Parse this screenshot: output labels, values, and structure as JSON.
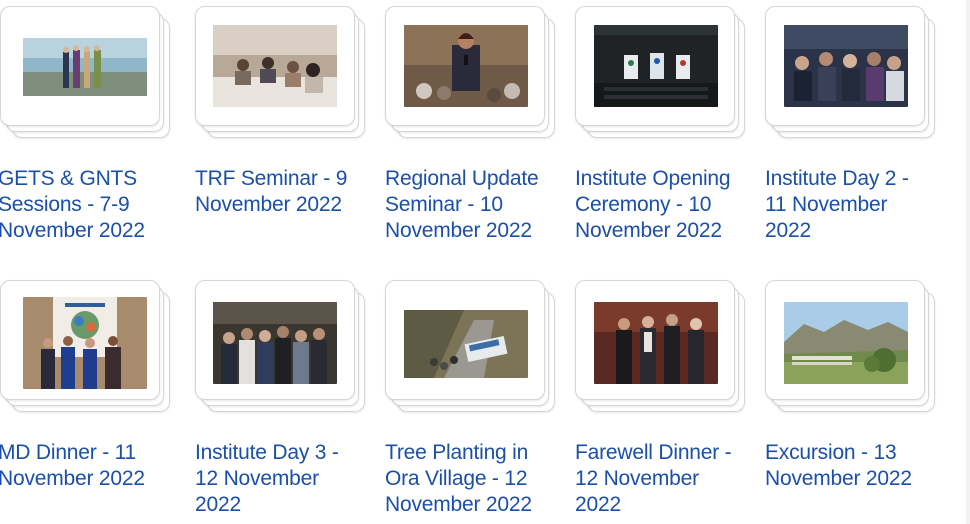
{
  "albums": [
    {
      "lines": [
        "GETS & GNTS",
        "Sessions - 7-9",
        "November 2022"
      ],
      "photo_icon": "group-photo-icon"
    },
    {
      "lines": [
        "TRF Seminar - 9",
        "November 2022"
      ],
      "photo_icon": "seminar-photo-icon"
    },
    {
      "lines": [
        "Regional Update",
        "Seminar - 10",
        "November 2022"
      ],
      "photo_icon": "speaker-photo-icon"
    },
    {
      "lines": [
        "Institute Opening",
        "Ceremony - 10",
        "November 2022"
      ],
      "photo_icon": "stage-photo-icon"
    },
    {
      "lines": [
        "Institute Day 2 -",
        "11 November",
        "2022"
      ],
      "photo_icon": "audience-photo-icon"
    },
    {
      "lines": [
        "MD Dinner - 11",
        "November 2022"
      ],
      "photo_icon": "dinner-photo-icon"
    },
    {
      "lines": [
        "Institute Day 3 -",
        "12 November",
        "2022"
      ],
      "photo_icon": "audience-photo-icon"
    },
    {
      "lines": [
        "Tree Planting in",
        "Ora Village - 12",
        "November 2022"
      ],
      "photo_icon": "bus-photo-icon"
    },
    {
      "lines": [
        "Farewell Dinner -",
        "12 November",
        "2022"
      ],
      "photo_icon": "dinner-photo-icon"
    },
    {
      "lines": [
        "Excursion - 13",
        "November 2022"
      ],
      "photo_icon": "landscape-photo-icon"
    }
  ],
  "colors": {
    "link": "#1b4fa8",
    "card_border": "#d6d6d6"
  }
}
